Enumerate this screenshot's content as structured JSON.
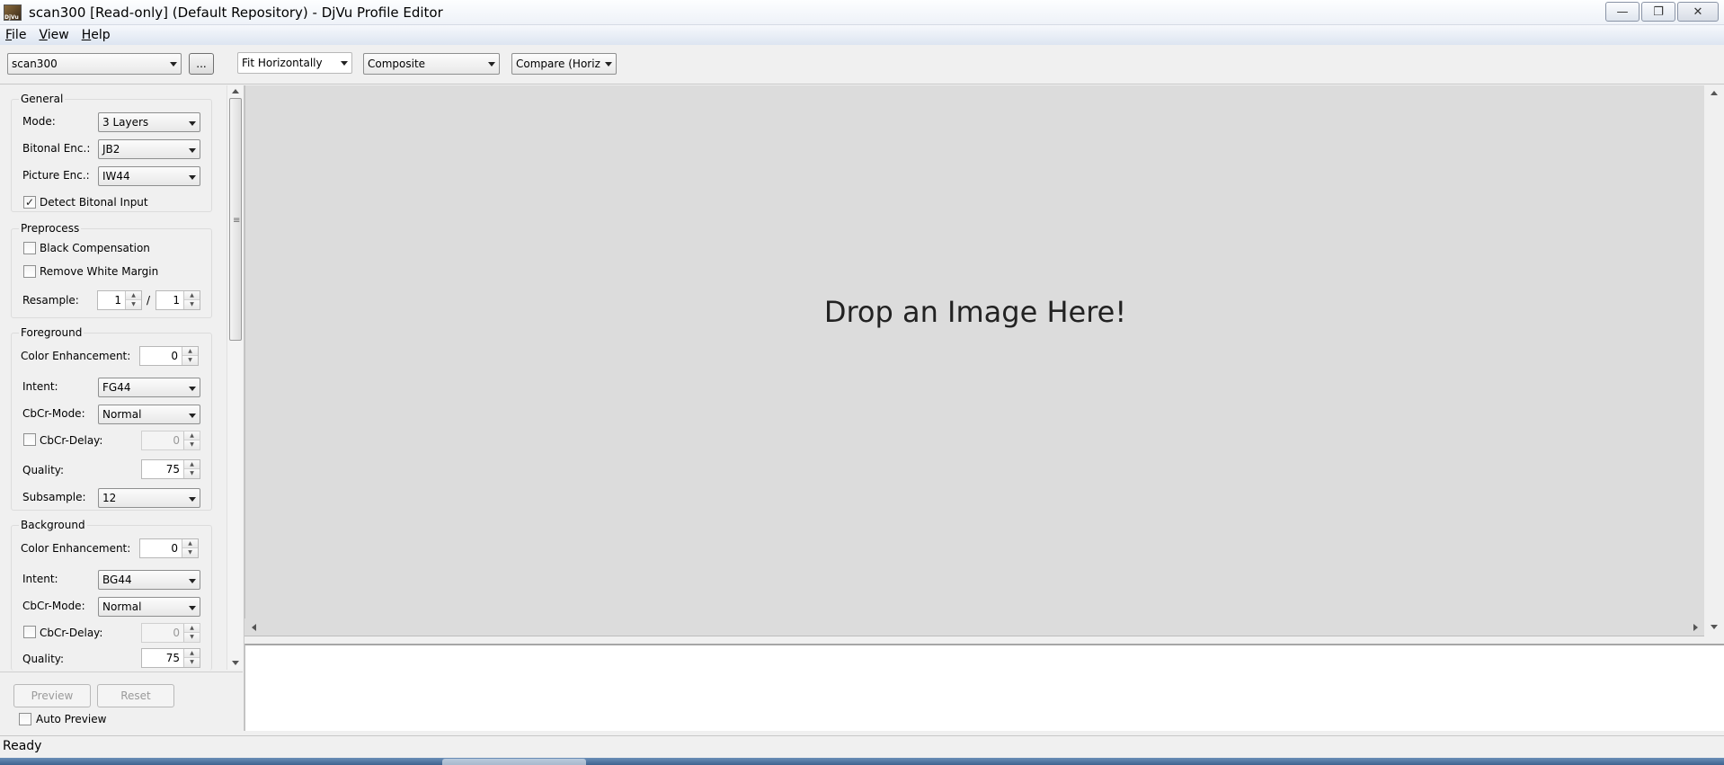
{
  "window": {
    "title": "scan300 [Read-only] (Default Repository) - DjVu Profile Editor",
    "controls": {
      "minimize": "—",
      "restore": "❐",
      "close": "✕"
    }
  },
  "menu": {
    "file": {
      "underline": "F",
      "rest": "ile"
    },
    "view": {
      "underline": "V",
      "rest": "iew"
    },
    "help": {
      "underline": "H",
      "rest": "elp"
    }
  },
  "toolbar": {
    "profile": "scan300",
    "browse_label": "...",
    "zoom": "Fit Horizontally",
    "display": "Composite",
    "compare": "Compare (Horiz"
  },
  "general": {
    "title": "General",
    "mode_label": "Mode:",
    "mode_value": "3 Layers",
    "bitonal_label": "Bitonal Enc.:",
    "bitonal_value": "JB2",
    "picture_label": "Picture Enc.:",
    "picture_value": "IW44",
    "detect_label": "Detect Bitonal Input",
    "detect_checked": true
  },
  "preprocess": {
    "title": "Preprocess",
    "black_comp_label": "Black Compensation",
    "remove_margin_label": "Remove White Margin",
    "resample_label": "Resample:",
    "resample_num": "1",
    "resample_sep": "/",
    "resample_den": "1"
  },
  "foreground": {
    "title": "Foreground",
    "color_enh_label": "Color Enhancement:",
    "color_enh_value": "0",
    "intent_label": "Intent:",
    "intent_value": "FG44",
    "cbcr_mode_label": "CbCr-Mode:",
    "cbcr_mode_value": "Normal",
    "cbcr_delay_label": "CbCr-Delay:",
    "cbcr_delay_value": "0",
    "quality_label": "Quality:",
    "quality_value": "75",
    "subsample_label": "Subsample:",
    "subsample_value": "12"
  },
  "background": {
    "title": "Background",
    "color_enh_label": "Color Enhancement:",
    "color_enh_value": "0",
    "intent_label": "Intent:",
    "intent_value": "BG44",
    "cbcr_mode_label": "CbCr-Mode:",
    "cbcr_mode_value": "Normal",
    "cbcr_delay_label": "CbCr-Delay:",
    "cbcr_delay_value": "0",
    "quality_label": "Quality:",
    "quality_value": "75"
  },
  "actions": {
    "preview_label": "Preview",
    "reset_label": "Reset",
    "auto_preview_label": "Auto Preview"
  },
  "canvas": {
    "drop_text": "Drop an Image Here!"
  },
  "status": {
    "text": "Ready"
  }
}
